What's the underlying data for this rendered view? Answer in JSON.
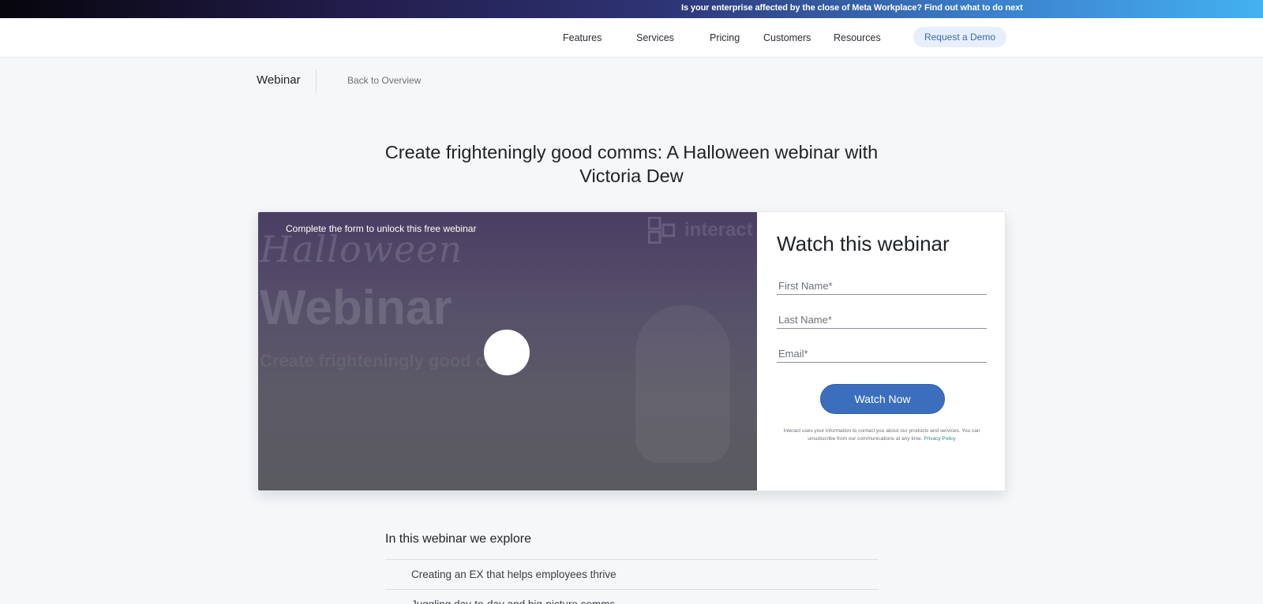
{
  "announcement": {
    "text": "Is your enterprise affected by the close of Meta Workplace? Find out what to do next"
  },
  "nav": {
    "items": [
      "Features",
      "Services",
      "Pricing",
      "Customers",
      "Resources"
    ],
    "demo_label": "Request a Demo"
  },
  "breadcrumb": {
    "section": "Webinar",
    "back_label": "Back to Overview"
  },
  "headline": "Create frighteningly good comms: A Halloween webinar with Victoria Dew",
  "video": {
    "unlock_text": "Complete the form to unlock this free webinar",
    "thumbnail": {
      "script_text": "Halloween",
      "big_text": "Webinar",
      "subtitle": "Create frighteningly good c",
      "brand": "interact"
    },
    "play_icon": "play-button-icon"
  },
  "form": {
    "title": "Watch this webinar",
    "fields": {
      "first_name": "First Name*",
      "last_name": "Last Name*",
      "email": "Email*"
    },
    "submit_label": "Watch Now",
    "legal_text": "Interact uses your information to contact you about our products and services. You can unsubscribe from our communications at any time.",
    "privacy_label": "Privacy Policy"
  },
  "explore": {
    "title": "In this webinar we explore",
    "items": [
      "Creating an EX that helps employees thrive",
      "Juggling day-to-day and big-picture comms"
    ]
  },
  "colors": {
    "accent": "#3b6fbd",
    "demo_bg": "#e6effb",
    "link": "#2f8a7e"
  }
}
